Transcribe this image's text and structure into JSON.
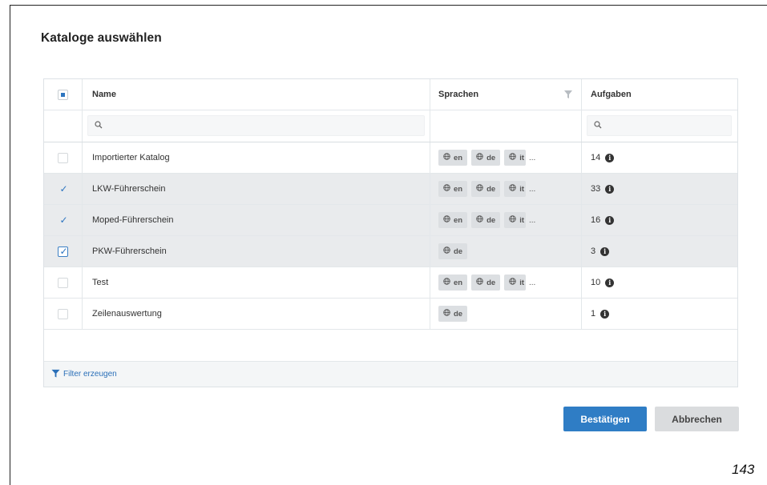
{
  "dialog": {
    "title": "Kataloge auswählen"
  },
  "table": {
    "headers": {
      "name": "Name",
      "languages": "Sprachen",
      "tasks": "Aufgaben"
    },
    "rows": [
      {
        "name": "Importierter Katalog",
        "selected": false,
        "languages": [
          "en",
          "de",
          "it"
        ],
        "truncated": true,
        "more": "...",
        "tasks": "14"
      },
      {
        "name": "LKW-Führerschein",
        "selected": true,
        "languages": [
          "en",
          "de",
          "it"
        ],
        "truncated": true,
        "more": "...",
        "tasks": "33"
      },
      {
        "name": "Moped-Führerschein",
        "selected": true,
        "languages": [
          "en",
          "de",
          "it"
        ],
        "truncated": true,
        "more": "...",
        "tasks": "16"
      },
      {
        "name": "PKW-Führerschein",
        "selected": true,
        "languages": [
          "de"
        ],
        "truncated": false,
        "more": "",
        "tasks": "3"
      },
      {
        "name": "Test",
        "selected": false,
        "languages": [
          "en",
          "de",
          "it"
        ],
        "truncated": true,
        "more": "...",
        "tasks": "10"
      },
      {
        "name": "Zeilenauswertung",
        "selected": false,
        "languages": [
          "de"
        ],
        "truncated": false,
        "more": "",
        "tasks": "1"
      }
    ],
    "footer": {
      "filter_label": "Filter erzeugen"
    }
  },
  "buttons": {
    "confirm": "Bestätigen",
    "cancel": "Abbrechen"
  },
  "page_number": "143",
  "colors": {
    "accent": "#2f7dc5",
    "selected_row": "#e9ebed",
    "chip": "#dcdfe2"
  }
}
